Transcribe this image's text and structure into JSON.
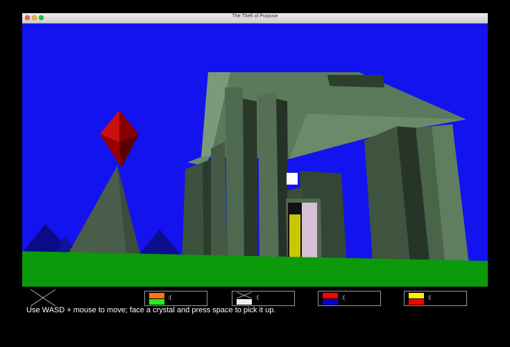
{
  "window": {
    "title": "The Theft of Purpose"
  },
  "hud": {
    "instructions": "Use WASD + mouse to move; face a crystal and press space to pick it up.",
    "slots": [
      {
        "face": ":(",
        "top_color": "#ff7700",
        "bottom_color": "#22ee22"
      },
      {
        "face": ":(",
        "top_color": "empty",
        "bottom_color": "#eeeeee"
      },
      {
        "face": ":(",
        "top_color": "#ff0000",
        "bottom_color": "#0000dd"
      },
      {
        "face": ":(",
        "top_color": "#ffee00",
        "bottom_color": "#ff0000"
      }
    ]
  },
  "colors": {
    "sky": "#1313f0",
    "grass": "#0a9a0a",
    "temple": "#4f6a4f",
    "crystal": "#c00000"
  }
}
